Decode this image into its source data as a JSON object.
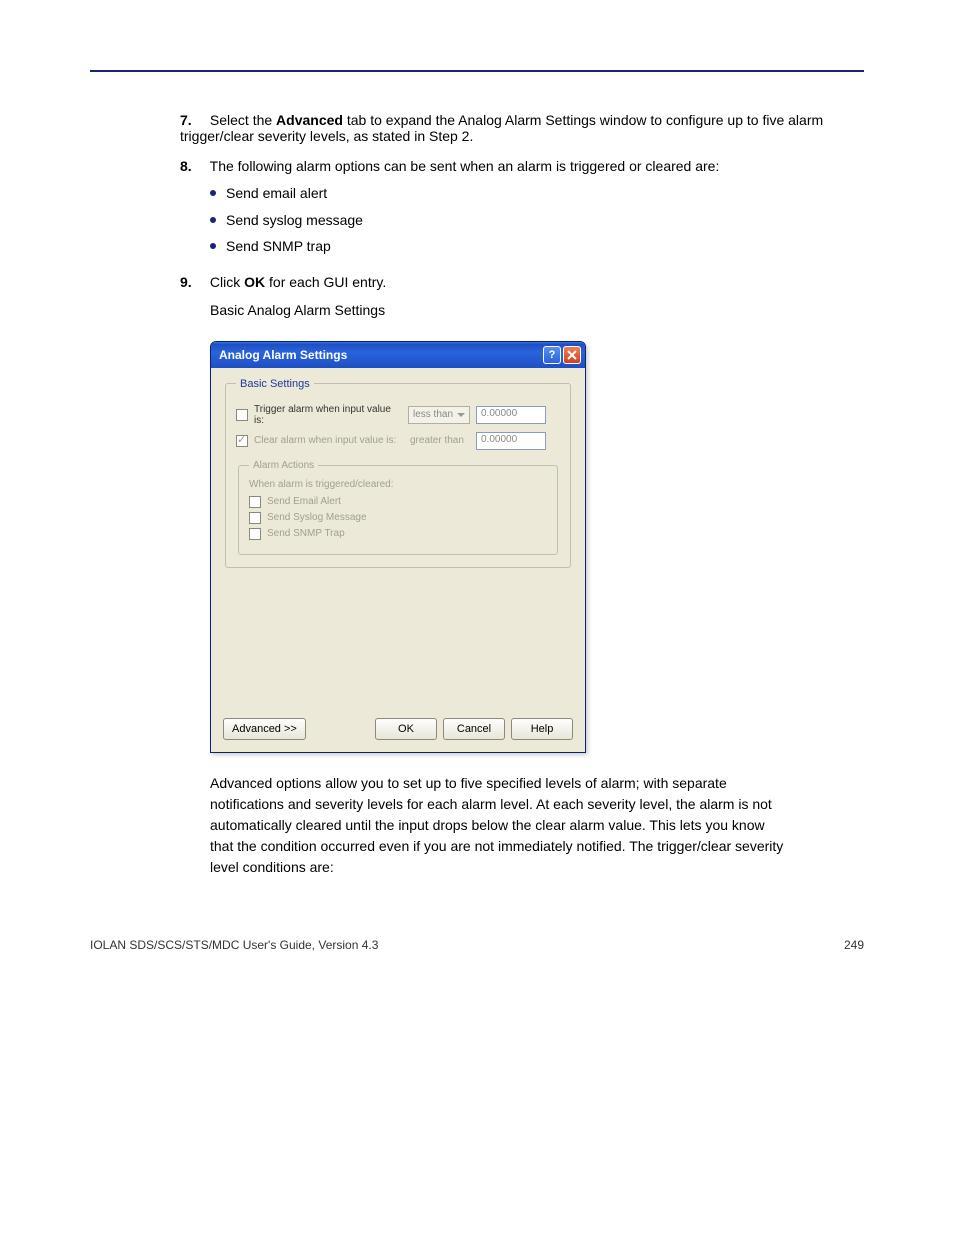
{
  "steps": {
    "s7_num": "7.",
    "s7_text_a": "Select the ",
    "s7_text_b": "Advanced ",
    "s7_text_c": "tab to expand the Analog Alarm Settings window to configure up to five alarm trigger/clear severity levels, as stated in Step 2.",
    "s8_num": "8.",
    "s8_text": "The following alarm options can be sent when an alarm is triggered or cleared are:",
    "bullets": [
      "Send email alert",
      "Send syslog message",
      "Send SNMP trap"
    ],
    "s9_num": "9.",
    "s9_text_a": "Click ",
    "s9_text_b": "OK ",
    "s9_text_c": "for each GUI entry."
  },
  "dialog": {
    "title": "Analog Alarm Settings",
    "fieldset_legend": "Basic Settings",
    "row1_label": "Trigger alarm when input value is:",
    "row1_select": "less than",
    "row1_value": "0.00000",
    "row2_label": "Clear alarm when input value is:",
    "row2_static": "greater than",
    "row2_value": "0.00000",
    "actions_legend": "Alarm Actions",
    "actions_sub": "When alarm is triggered/cleared:",
    "action1": "Send Email Alert",
    "action2": "Send Syslog Message",
    "action3": "Send SNMP Trap",
    "btn_advanced": "Advanced >>",
    "btn_ok": "OK",
    "btn_cancel": "Cancel",
    "btn_help": "Help"
  },
  "para_after": "Advanced options allow you to set up to five specified levels of alarm; with separate notifications and severity levels for each alarm level. At each severity level, the alarm is not automatically cleared until the input drops below the clear alarm value. This lets you know that the condition occurred even if you are not immediately notified. The trigger/clear severity level conditions are:",
  "footer": {
    "left": "IOLAN SDS/SCS/STS/MDC User's Guide, Version 4.3",
    "right": "249"
  }
}
